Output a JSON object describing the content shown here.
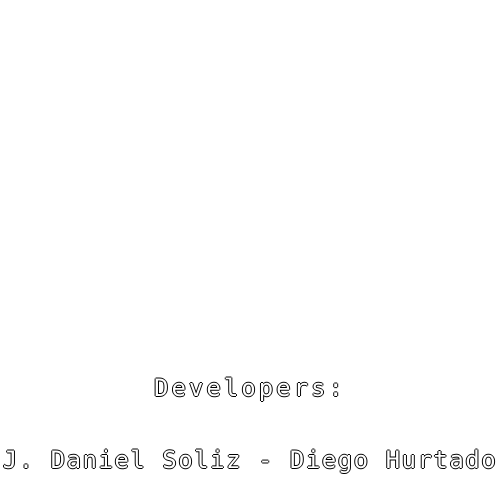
{
  "credits": {
    "heading": "Developers:",
    "names": "J. Daniel Soliz - Diego Hurtado"
  },
  "colors": {
    "background": "#ffffff",
    "text_fill": "#ffffff",
    "text_outline": "#000000"
  }
}
